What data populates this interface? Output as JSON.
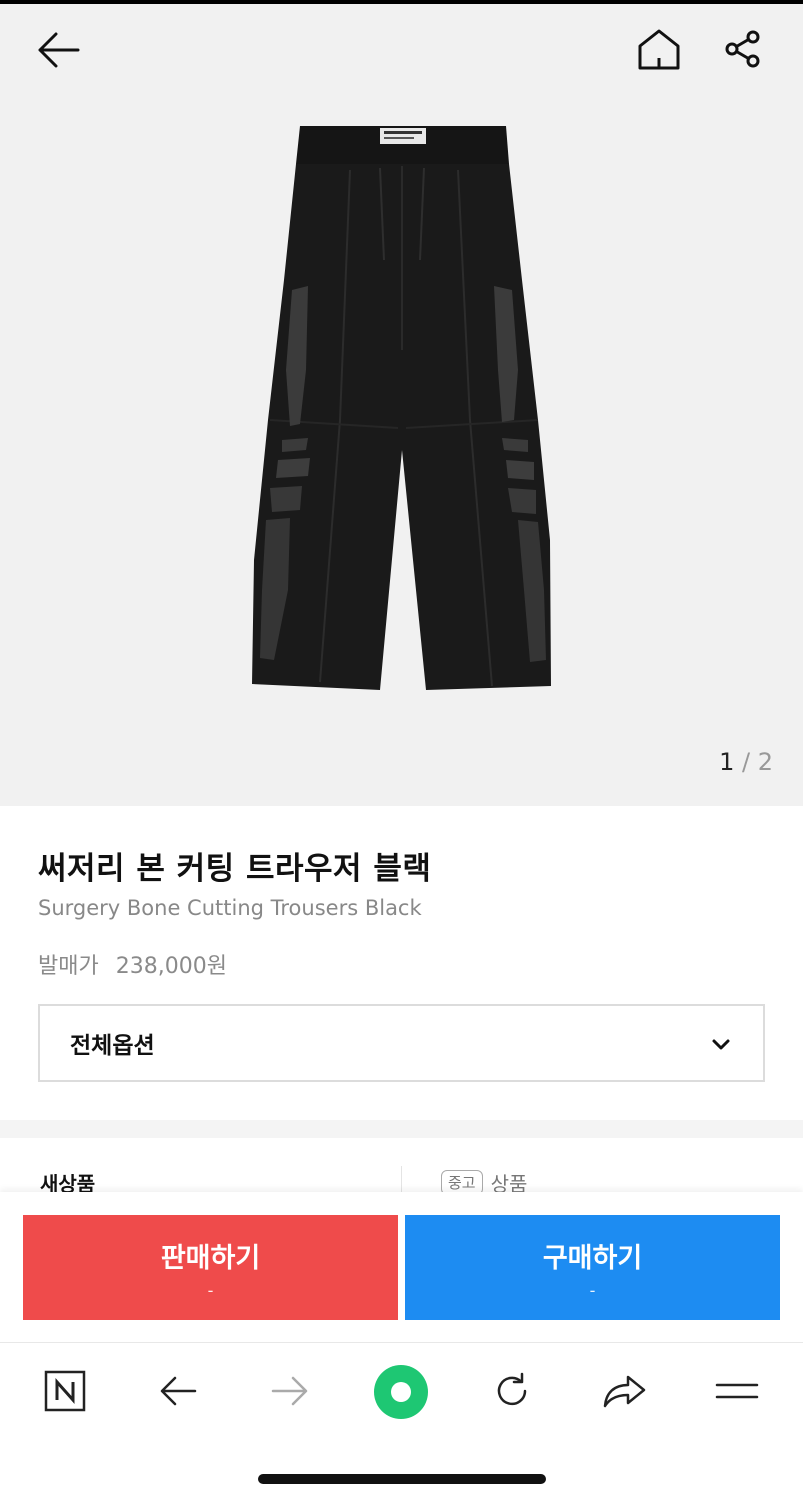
{
  "icons": {
    "back": "arrow-left-icon",
    "home": "home-icon",
    "share": "share-icon",
    "dropdown": "chevron-down-icon",
    "naver": "naver-n-icon",
    "browser_back": "arrow-left-icon",
    "browser_forward": "arrow-right-icon",
    "green_dot": "green-dot-icon",
    "refresh": "refresh-icon",
    "browser_share": "share-arrow-icon",
    "menu": "hamburger-menu-icon"
  },
  "gallery": {
    "current": "1",
    "separator": "/",
    "total": "2"
  },
  "product": {
    "title_ko": "써저리 본 커팅 트라우저 블랙",
    "title_en": "Surgery Bone Cutting Trousers Black",
    "release_label": "발매가",
    "release_price": "238,000원"
  },
  "options": {
    "selected": "전체옵션"
  },
  "tabs": {
    "new_label": "새상품",
    "used_badge": "중고",
    "used_label": "상품"
  },
  "actions": {
    "sell_label": "판매하기",
    "sell_sub": "-",
    "buy_label": "구매하기",
    "buy_sub": "-"
  },
  "colors": {
    "sell": "#ef4b4b",
    "buy": "#1d8cf2",
    "hero_bg": "#f1f1f1",
    "green_button": "#1ec773"
  }
}
